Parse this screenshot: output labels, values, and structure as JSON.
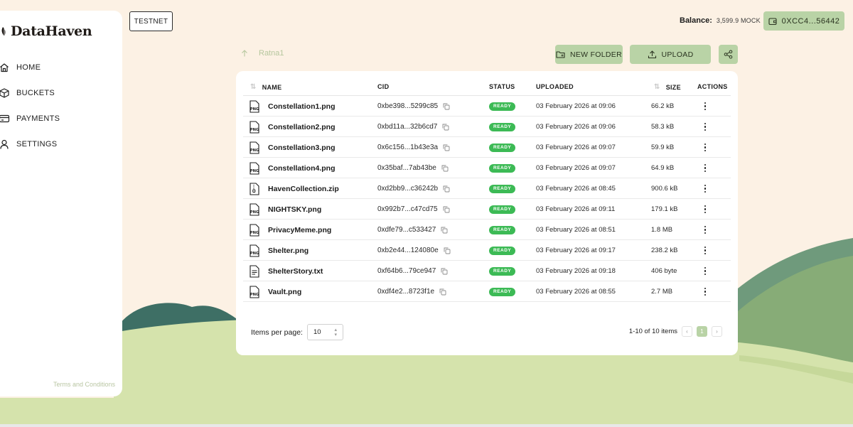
{
  "app": {
    "name": "DataHaven"
  },
  "sidebar": {
    "items": [
      {
        "label": "HOME",
        "icon": "home-icon"
      },
      {
        "label": "BUCKETS",
        "icon": "cube-icon"
      },
      {
        "label": "PAYMENTS",
        "icon": "credit-card-icon"
      },
      {
        "label": "SETTINGS",
        "icon": "user-icon"
      }
    ],
    "terms": "Terms and Conditions"
  },
  "header": {
    "network": "TESTNET",
    "balance_label": "Balance:",
    "balance_value": "3,599.9 MOCK",
    "wallet": "0XCC4...56442"
  },
  "toolbar": {
    "breadcrumb": "Ratna1",
    "new_folder": "NEW FOLDER",
    "upload": "UPLOAD"
  },
  "table": {
    "columns": [
      "NAME",
      "CID",
      "STATUS",
      "UPLOADED",
      "SIZE",
      "ACTIONS"
    ],
    "rows": [
      {
        "name": "Constellation1.png",
        "type": "png",
        "cid": "0xbe398...5299c85",
        "status": "READY",
        "uploaded": "03 February 2026 at 09:06",
        "size": "66.2 kB"
      },
      {
        "name": "Constellation2.png",
        "type": "png",
        "cid": "0xbd11a...32b6cd7",
        "status": "READY",
        "uploaded": "03 February 2026 at 09:06",
        "size": "58.3 kB"
      },
      {
        "name": "Constellation3.png",
        "type": "png",
        "cid": "0x6c156...1b43e3a",
        "status": "READY",
        "uploaded": "03 February 2026 at 09:07",
        "size": "59.9 kB"
      },
      {
        "name": "Constellation4.png",
        "type": "png",
        "cid": "0x35baf...7ab43be",
        "status": "READY",
        "uploaded": "03 February 2026 at 09:07",
        "size": "64.9 kB"
      },
      {
        "name": "HavenCollection.zip",
        "type": "zip",
        "cid": "0xd2bb9...c36242b",
        "status": "READY",
        "uploaded": "03 February 2026 at 08:45",
        "size": "900.6 kB"
      },
      {
        "name": "NIGHTSKY.png",
        "type": "png",
        "cid": "0x992b7...c47cd75",
        "status": "READY",
        "uploaded": "03 February 2026 at 09:11",
        "size": "179.1 kB"
      },
      {
        "name": "PrivacyMeme.png",
        "type": "png",
        "cid": "0xdfe79...c533427",
        "status": "READY",
        "uploaded": "03 February 2026 at 08:51",
        "size": "1.8 MB"
      },
      {
        "name": "Shelter.png",
        "type": "png",
        "cid": "0xb2e44...124080e",
        "status": "READY",
        "uploaded": "03 February 2026 at 09:17",
        "size": "238.2 kB"
      },
      {
        "name": "ShelterStory.txt",
        "type": "txt",
        "cid": "0xf64b6...79ce947",
        "status": "READY",
        "uploaded": "03 February 2026 at 09:18",
        "size": "406 byte"
      },
      {
        "name": "Vault.png",
        "type": "png",
        "cid": "0xdf4e2...8723f1e",
        "status": "READY",
        "uploaded": "03 February 2026 at 08:55",
        "size": "2.7 MB"
      }
    ]
  },
  "pagination": {
    "items_per_page_label": "Items per page:",
    "items_per_page": "10",
    "range": "1-10 of 10 items",
    "current_page": "1"
  },
  "colors": {
    "accent": "#b9d3a6",
    "ready": "#3cba55",
    "background": "#fcf1e4"
  }
}
